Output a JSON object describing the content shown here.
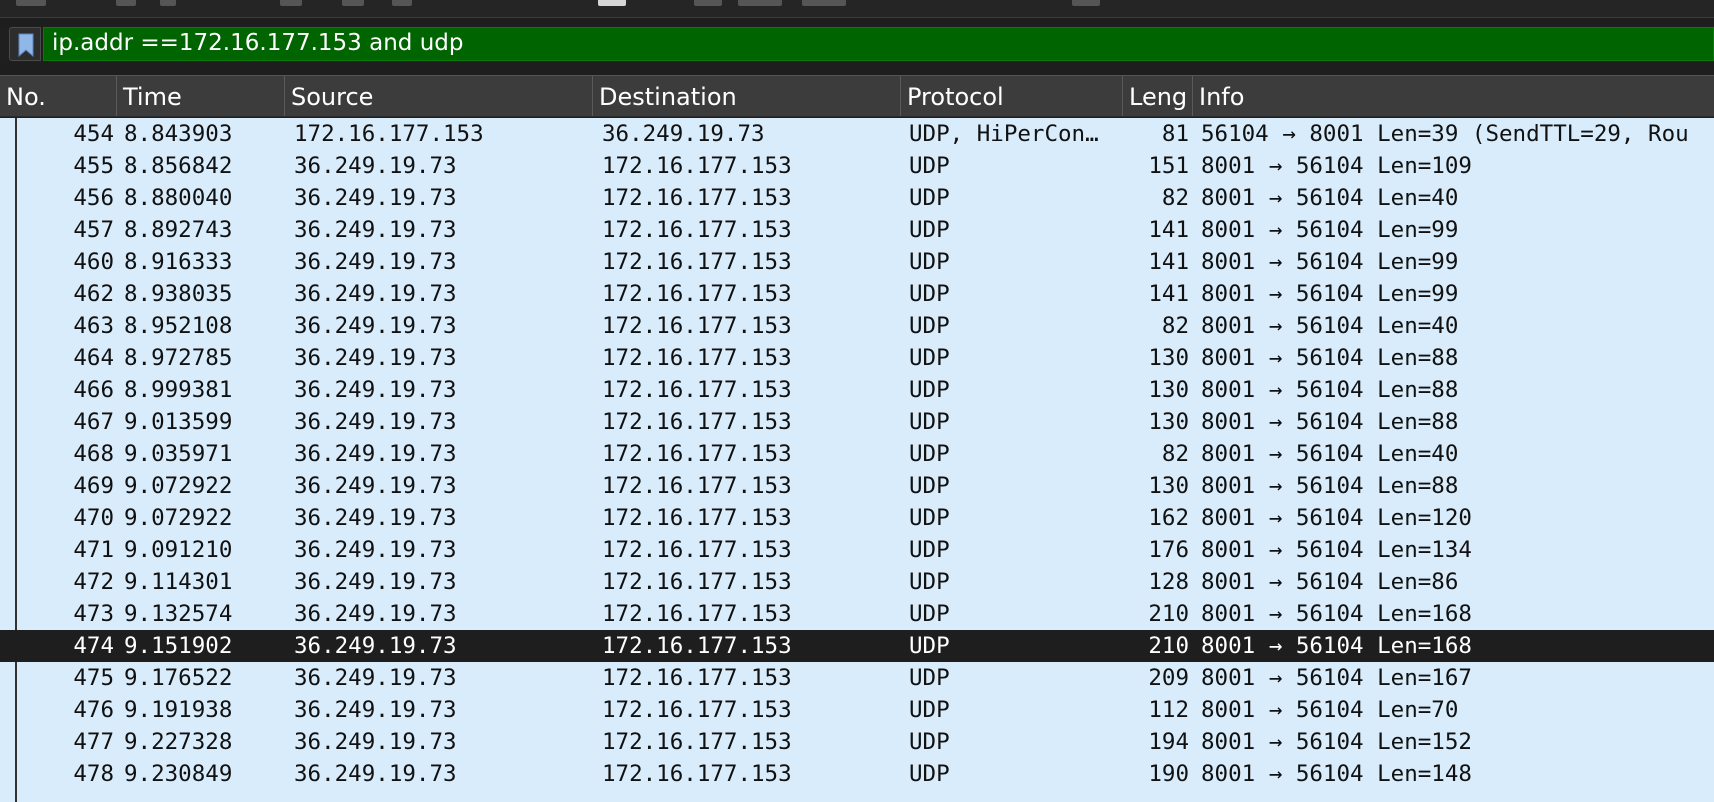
{
  "filter": {
    "value": "ip.addr ==172.16.177.153 and udp"
  },
  "columns": [
    "No.",
    "Time",
    "Source",
    "Destination",
    "Protocol",
    "Leng",
    "Info"
  ],
  "selected_no": "474",
  "packets": [
    {
      "no": "454",
      "time": "8.843903",
      "src": "172.16.177.153",
      "dst": "36.249.19.73",
      "proto": "UDP, HiPerCon…",
      "len": "81",
      "info": "56104 → 8001 Len=39 (SendTTL=29, Rou"
    },
    {
      "no": "455",
      "time": "8.856842",
      "src": "36.249.19.73",
      "dst": "172.16.177.153",
      "proto": "UDP",
      "len": "151",
      "info": "8001 → 56104 Len=109"
    },
    {
      "no": "456",
      "time": "8.880040",
      "src": "36.249.19.73",
      "dst": "172.16.177.153",
      "proto": "UDP",
      "len": "82",
      "info": "8001 → 56104 Len=40"
    },
    {
      "no": "457",
      "time": "8.892743",
      "src": "36.249.19.73",
      "dst": "172.16.177.153",
      "proto": "UDP",
      "len": "141",
      "info": "8001 → 56104 Len=99"
    },
    {
      "no": "460",
      "time": "8.916333",
      "src": "36.249.19.73",
      "dst": "172.16.177.153",
      "proto": "UDP",
      "len": "141",
      "info": "8001 → 56104 Len=99"
    },
    {
      "no": "462",
      "time": "8.938035",
      "src": "36.249.19.73",
      "dst": "172.16.177.153",
      "proto": "UDP",
      "len": "141",
      "info": "8001 → 56104 Len=99"
    },
    {
      "no": "463",
      "time": "8.952108",
      "src": "36.249.19.73",
      "dst": "172.16.177.153",
      "proto": "UDP",
      "len": "82",
      "info": "8001 → 56104 Len=40"
    },
    {
      "no": "464",
      "time": "8.972785",
      "src": "36.249.19.73",
      "dst": "172.16.177.153",
      "proto": "UDP",
      "len": "130",
      "info": "8001 → 56104 Len=88"
    },
    {
      "no": "466",
      "time": "8.999381",
      "src": "36.249.19.73",
      "dst": "172.16.177.153",
      "proto": "UDP",
      "len": "130",
      "info": "8001 → 56104 Len=88"
    },
    {
      "no": "467",
      "time": "9.013599",
      "src": "36.249.19.73",
      "dst": "172.16.177.153",
      "proto": "UDP",
      "len": "130",
      "info": "8001 → 56104 Len=88"
    },
    {
      "no": "468",
      "time": "9.035971",
      "src": "36.249.19.73",
      "dst": "172.16.177.153",
      "proto": "UDP",
      "len": "82",
      "info": "8001 → 56104 Len=40"
    },
    {
      "no": "469",
      "time": "9.072922",
      "src": "36.249.19.73",
      "dst": "172.16.177.153",
      "proto": "UDP",
      "len": "130",
      "info": "8001 → 56104 Len=88"
    },
    {
      "no": "470",
      "time": "9.072922",
      "src": "36.249.19.73",
      "dst": "172.16.177.153",
      "proto": "UDP",
      "len": "162",
      "info": "8001 → 56104 Len=120"
    },
    {
      "no": "471",
      "time": "9.091210",
      "src": "36.249.19.73",
      "dst": "172.16.177.153",
      "proto": "UDP",
      "len": "176",
      "info": "8001 → 56104 Len=134"
    },
    {
      "no": "472",
      "time": "9.114301",
      "src": "36.249.19.73",
      "dst": "172.16.177.153",
      "proto": "UDP",
      "len": "128",
      "info": "8001 → 56104 Len=86"
    },
    {
      "no": "473",
      "time": "9.132574",
      "src": "36.249.19.73",
      "dst": "172.16.177.153",
      "proto": "UDP",
      "len": "210",
      "info": "8001 → 56104 Len=168"
    },
    {
      "no": "474",
      "time": "9.151902",
      "src": "36.249.19.73",
      "dst": "172.16.177.153",
      "proto": "UDP",
      "len": "210",
      "info": "8001 → 56104 Len=168"
    },
    {
      "no": "475",
      "time": "9.176522",
      "src": "36.249.19.73",
      "dst": "172.16.177.153",
      "proto": "UDP",
      "len": "209",
      "info": "8001 → 56104 Len=167"
    },
    {
      "no": "476",
      "time": "9.191938",
      "src": "36.249.19.73",
      "dst": "172.16.177.153",
      "proto": "UDP",
      "len": "112",
      "info": "8001 → 56104 Len=70"
    },
    {
      "no": "477",
      "time": "9.227328",
      "src": "36.249.19.73",
      "dst": "172.16.177.153",
      "proto": "UDP",
      "len": "194",
      "info": "8001 → 56104 Len=152"
    },
    {
      "no": "478",
      "time": "9.230849",
      "src": "36.249.19.73",
      "dst": "172.16.177.153",
      "proto": "UDP",
      "len": "190",
      "info": "8001 → 56104 Len=148"
    }
  ]
}
